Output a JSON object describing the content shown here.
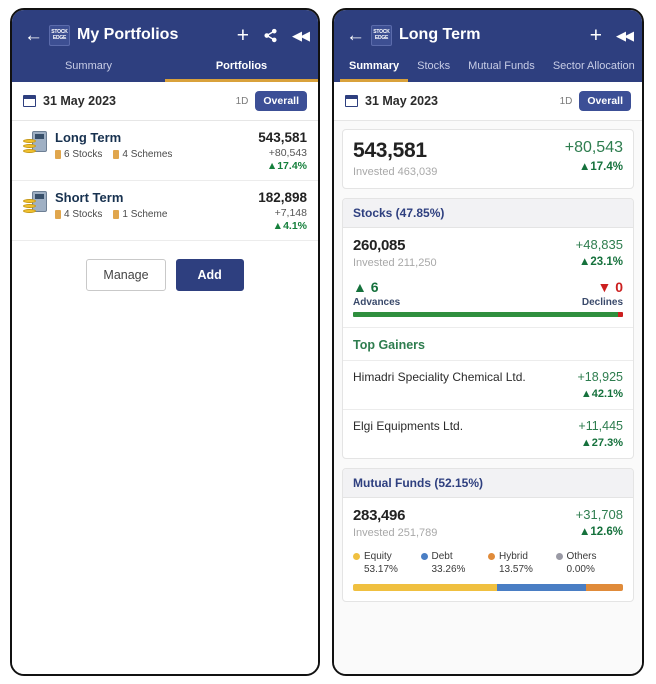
{
  "left": {
    "appbar": {
      "back_icon": "back-arrow-icon",
      "logo_line1": "STOCK",
      "logo_line2": "EDGE",
      "title": "My Portfolios",
      "add_icon": "+",
      "share_icon": "share-icon",
      "rewind_icon": "◀◀"
    },
    "tabs": [
      {
        "label": "Summary",
        "active": false
      },
      {
        "label": "Portfolios",
        "active": true
      }
    ],
    "date_row": {
      "date": "31 May 2023",
      "period_1d": "1D",
      "period_overall": "Overall"
    },
    "portfolios": [
      {
        "name": "Long Term",
        "stocks_tag": "6 Stocks",
        "schemes_tag": "4 Schemes",
        "value": "543,581",
        "gain": "+80,543",
        "pct": "▲17.4%"
      },
      {
        "name": "Short Term",
        "stocks_tag": "4 Stocks",
        "schemes_tag": "1 Scheme",
        "value": "182,898",
        "gain": "+7,148",
        "pct": "▲4.1%"
      }
    ],
    "buttons": {
      "manage": "Manage",
      "add": "Add"
    }
  },
  "right": {
    "appbar": {
      "back_icon": "back-arrow-icon",
      "logo_line1": "STOCK",
      "logo_line2": "EDGE",
      "title": "Long Term",
      "add_icon": "+",
      "rewind_icon": "◀◀"
    },
    "tabs": [
      {
        "label": "Summary",
        "active": true
      },
      {
        "label": "Stocks",
        "active": false
      },
      {
        "label": "Mutual Funds",
        "active": false
      },
      {
        "label": "Sector Allocation",
        "active": false
      }
    ],
    "date_row": {
      "date": "31 May 2023",
      "period_1d": "1D",
      "period_overall": "Overall"
    },
    "total": {
      "value": "543,581",
      "invested": "Invested 463,039",
      "gain": "+80,543",
      "pct": "▲17.4%"
    },
    "stocks": {
      "header": "Stocks (47.85%)",
      "value": "260,085",
      "invested": "Invested 211,250",
      "gain": "+48,835",
      "pct": "▲23.1%",
      "advances_value": "▲ 6",
      "advances_label": "Advances",
      "declines_value": "▼ 0",
      "declines_label": "Declines",
      "advances_share": 98,
      "declines_share": 2,
      "advances_color": "#2f8f3e",
      "declines_color": "#cc2020",
      "gainers_title": "Top Gainers",
      "gainers": [
        {
          "name": "Himadri Speciality Chemical Ltd.",
          "amount": "+18,925",
          "pct": "▲42.1%"
        },
        {
          "name": "Elgi Equipments Ltd.",
          "amount": "+11,445",
          "pct": "▲27.3%"
        }
      ]
    },
    "mutual_funds": {
      "header": "Mutual Funds (52.15%)",
      "value": "283,496",
      "invested": "Invested 251,789",
      "gain": "+31,708",
      "pct": "▲12.6%",
      "allocation": [
        {
          "label": "Equity",
          "pct": "53.17%",
          "value": 53.17,
          "color": "#f0c040"
        },
        {
          "label": "Debt",
          "pct": "33.26%",
          "value": 33.26,
          "color": "#4a7ec4"
        },
        {
          "label": "Hybrid",
          "pct": "13.57%",
          "value": 13.57,
          "color": "#e08b3a"
        },
        {
          "label": "Others",
          "pct": "0.00%",
          "value": 0.0,
          "color": "#9a9aa5"
        }
      ]
    }
  }
}
